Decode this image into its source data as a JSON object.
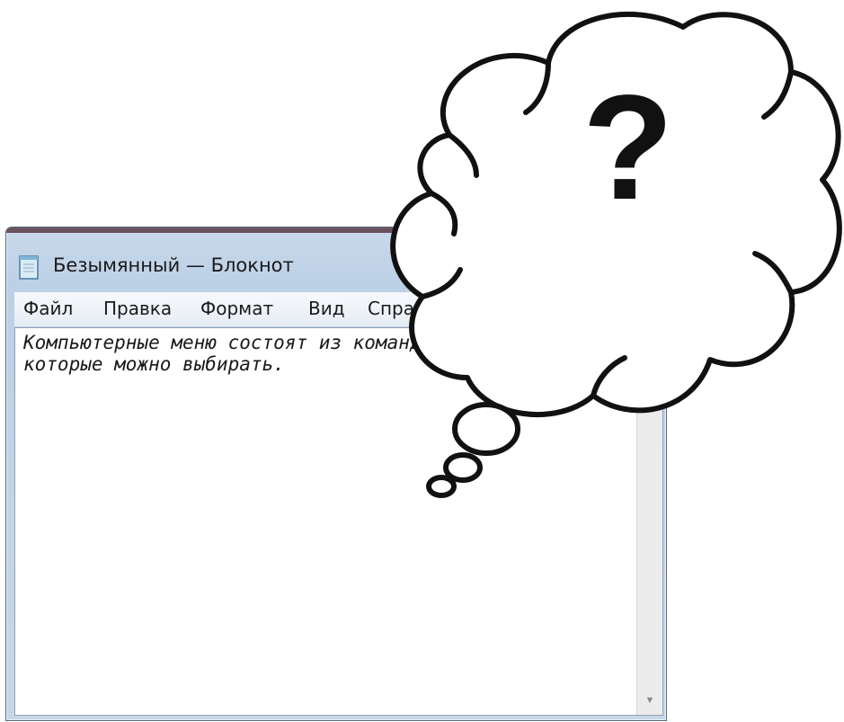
{
  "window": {
    "title": "Безымянный — Блокнот"
  },
  "menu": {
    "items": [
      "Файл",
      "Правка",
      "Формат",
      "Вид",
      "Справка"
    ]
  },
  "editor": {
    "line1": "Компьютерные меню состоят из команд,",
    "line2": "которые можно выбирать."
  },
  "thought_bubble": {
    "symbol": "?"
  },
  "icons": {
    "app": "notepad-icon",
    "minimize": "minimize-icon",
    "maximize": "maximize-icon",
    "close": "close-icon",
    "scroll_up": "scroll-up-arrow-icon",
    "scroll_down": "scroll-down-arrow-icon"
  }
}
